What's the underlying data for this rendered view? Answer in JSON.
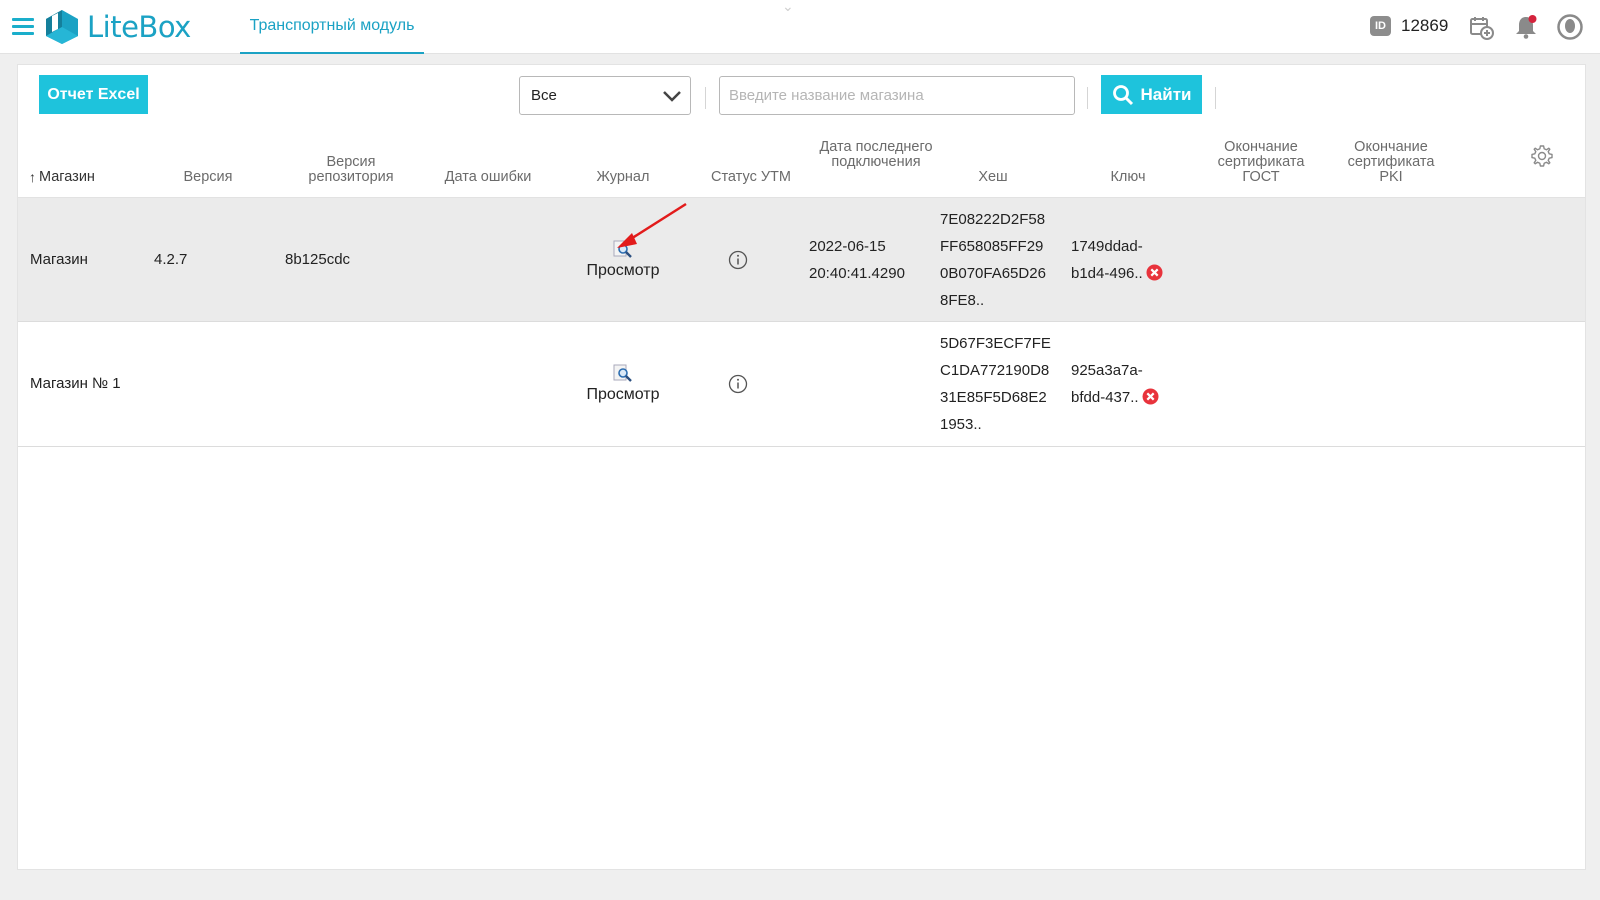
{
  "header": {
    "logo_text": "LiteBox",
    "nav_tab": "Транспортный модуль",
    "id_badge": "ID",
    "id_value": "12869"
  },
  "toolbar": {
    "excel_button": "Отчет Excel",
    "filter_selected": "Все",
    "search_placeholder": "Введите название магазина",
    "search_value": "",
    "find_button": "Найти"
  },
  "table": {
    "columns": {
      "store": "Магазин",
      "version": "Версия",
      "repo_version": "Версия репозитория",
      "error_date": "Дата ошибки",
      "journal": "Журнал",
      "utm_status": "Статус УТМ",
      "last_connection": "Дата последнего подключения",
      "hash": "Хеш",
      "key": "Ключ",
      "gost_cert_end": "Окончание сертификата ГОСТ",
      "pki_cert_end": "Окончание сертификата PKI"
    },
    "rows": [
      {
        "store": "Магазин",
        "version": "4.2.7",
        "repo_version": "8b125cdc",
        "error_date": "",
        "journal_label": "Просмотр",
        "last_connection_date": "2022-06-15",
        "last_connection_time": "20:40:41.4290",
        "hash_lines": [
          "7E08222D2F58",
          "FF658085FF29",
          "0B070FA65D26",
          "8FE8.."
        ],
        "key_lines": [
          "1749ddad-",
          "b1d4-496.."
        ],
        "gost": "",
        "pki": ""
      },
      {
        "store": "Магазин № 1",
        "version": "",
        "repo_version": "",
        "error_date": "",
        "journal_label": "Просмотр",
        "last_connection_date": "",
        "last_connection_time": "",
        "hash_lines": [
          "5D67F3ECF7FE",
          "C1DA772190D8",
          "31E85F5D68E2",
          "1953.."
        ],
        "key_lines": [
          "925a3a7a-",
          "bfdd-437.."
        ],
        "gost": "",
        "pki": ""
      }
    ]
  },
  "colors": {
    "accent": "#1ec3dc",
    "brand": "#1ba2c4",
    "error": "#e8333c",
    "annotation_arrow": "#e21b1b"
  }
}
